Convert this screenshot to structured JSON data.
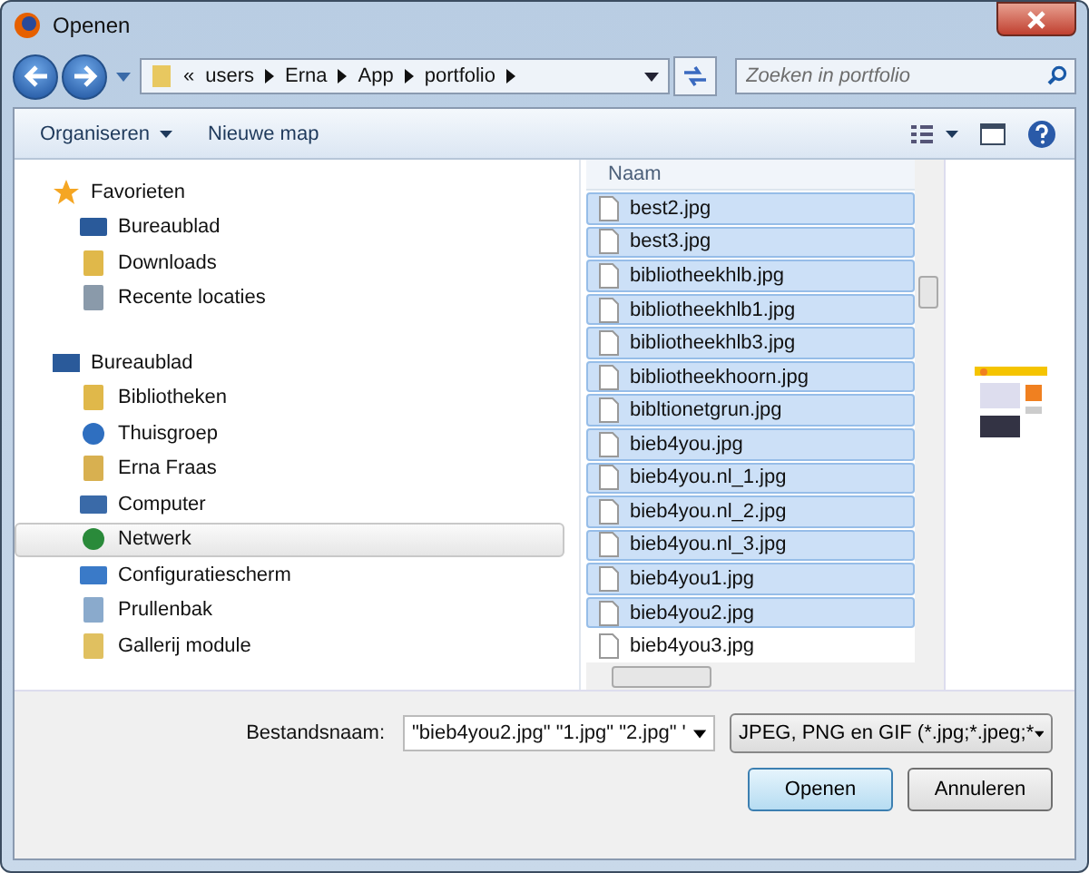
{
  "window": {
    "title": "Openen"
  },
  "address": {
    "overflow": "«",
    "segments": [
      "users",
      "Erna",
      "App",
      "portfolio"
    ]
  },
  "search": {
    "placeholder": "Zoeken in portfolio"
  },
  "toolbar": {
    "organize": "Organiseren",
    "new_folder": "Nieuwe map"
  },
  "nav": [
    {
      "label": "Favorieten",
      "kind": "star",
      "selected": false,
      "children": [
        {
          "label": "Bureaublad",
          "kind": "desktop",
          "selected": false
        },
        {
          "label": "Downloads",
          "kind": "download",
          "selected": false
        },
        {
          "label": "Recente locaties",
          "kind": "recent",
          "selected": false
        }
      ]
    },
    {
      "label": "Bureaublad",
      "kind": "desktop",
      "selected": false,
      "children": [
        {
          "label": "Bibliotheken",
          "kind": "library",
          "selected": false
        },
        {
          "label": "Thuisgroep",
          "kind": "homegroup",
          "selected": false
        },
        {
          "label": "Erna Fraas",
          "kind": "user",
          "selected": false
        },
        {
          "label": "Computer",
          "kind": "computer",
          "selected": false
        },
        {
          "label": "Netwerk",
          "kind": "network",
          "selected": true
        },
        {
          "label": "Configuratiescherm",
          "kind": "control",
          "selected": false
        },
        {
          "label": "Prullenbak",
          "kind": "trash",
          "selected": false
        },
        {
          "label": "Gallerij module",
          "kind": "folder",
          "selected": false
        }
      ]
    }
  ],
  "file_list": {
    "column": "Naam",
    "files": [
      {
        "name": "best2.jpg",
        "selected": true
      },
      {
        "name": "best3.jpg",
        "selected": true
      },
      {
        "name": "bibliotheekhlb.jpg",
        "selected": true
      },
      {
        "name": "bibliotheekhlb1.jpg",
        "selected": true
      },
      {
        "name": "bibliotheekhlb3.jpg",
        "selected": true
      },
      {
        "name": "bibliotheekhoorn.jpg",
        "selected": true
      },
      {
        "name": "bibltionetgrun.jpg",
        "selected": true
      },
      {
        "name": "bieb4you.jpg",
        "selected": true
      },
      {
        "name": "bieb4you.nl_1.jpg",
        "selected": true
      },
      {
        "name": "bieb4you.nl_2.jpg",
        "selected": true
      },
      {
        "name": "bieb4you.nl_3.jpg",
        "selected": true
      },
      {
        "name": "bieb4you1.jpg",
        "selected": true
      },
      {
        "name": "bieb4you2.jpg",
        "selected": true
      },
      {
        "name": "bieb4you3.jpg",
        "selected": false
      }
    ]
  },
  "filename": {
    "label": "Bestandsnaam:",
    "value": "\"bieb4you2.jpg\" \"1.jpg\" \"2.jpg\" '"
  },
  "filetype": {
    "value": "JPEG, PNG en GIF (*.jpg;*.jpeg;*"
  },
  "buttons": [
    {
      "label": "Openen",
      "kind": "primary"
    },
    {
      "label": "Annuleren",
      "kind": "normal"
    }
  ]
}
